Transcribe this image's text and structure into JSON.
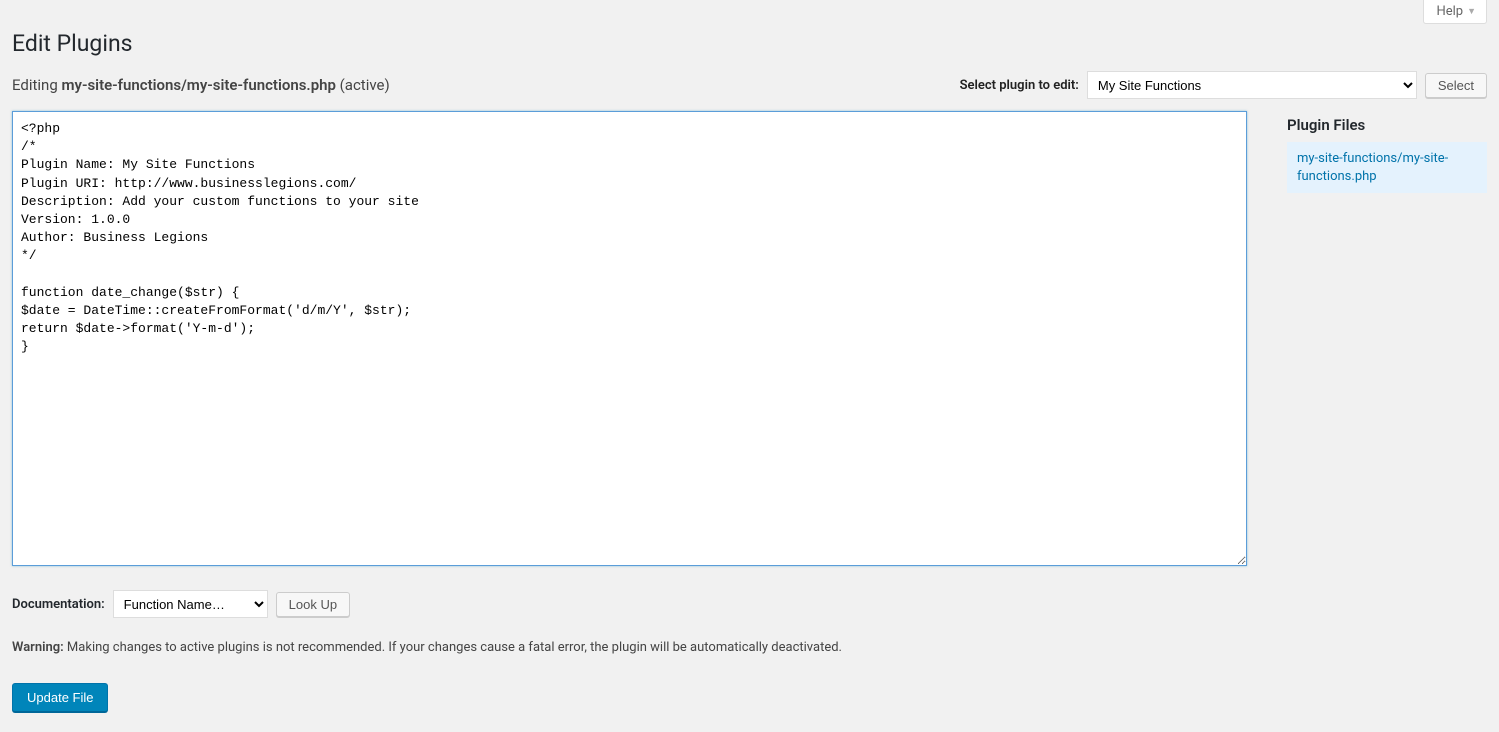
{
  "help": {
    "label": "Help"
  },
  "page_title": "Edit Plugins",
  "editing": {
    "prefix": "Editing ",
    "filename": "my-site-functions/my-site-functions.php",
    "status": " (active)"
  },
  "picker": {
    "label": "Select plugin to edit:",
    "selected": "My Site Functions",
    "button": "Select"
  },
  "editor_content": "<?php\n/*\nPlugin Name: My Site Functions\nPlugin URI: http://www.businesslegions.com/\nDescription: Add your custom functions to your site\nVersion: 1.0.0\nAuthor: Business Legions\n*/\n\nfunction date_change($str) {\n$date = DateTime::createFromFormat('d/m/Y', $str);\nreturn $date->format('Y-m-d');\n}\n",
  "files": {
    "heading": "Plugin Files",
    "current": "my-site-functions/my-site-functions.php"
  },
  "documentation": {
    "label": "Documentation:",
    "selected": "Function Name…",
    "button": "Look Up"
  },
  "warning": {
    "label": "Warning:",
    "text": " Making changes to active plugins is not recommended. If your changes cause a fatal error, the plugin will be automatically deactivated."
  },
  "submit": {
    "label": "Update File"
  }
}
